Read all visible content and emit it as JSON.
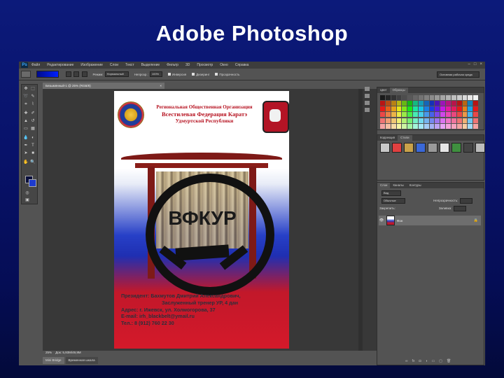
{
  "slide_title": "Adobe Photoshop",
  "photoshop": {
    "app_logo": "Ps",
    "menu": [
      "Файл",
      "Редактирование",
      "Изображение",
      "Слои",
      "Текст",
      "Выделение",
      "Фильтр",
      "3D",
      "Просмотр",
      "Окно",
      "Справка"
    ],
    "window_controls": [
      "–",
      "□",
      "×"
    ],
    "options_bar": {
      "mode_label": "Режим:",
      "mode_value": "Нормальный",
      "opacity_label": "Непрозр.:",
      "opacity_value": "100%",
      "checkboxes": [
        "Инверсия",
        "Дизеринг",
        "Прозрачность"
      ],
      "workspace": "Основная рабочая среда"
    },
    "document_tab": "Безымянный-1 @ 25% (RGB/8)",
    "tab_close": "×",
    "status": {
      "zoom": "25%",
      "doc_info": "Док: 5,93M/49,9M"
    },
    "bottom_tabs": [
      "Mini Bridge",
      "Временная шкала"
    ],
    "panels": {
      "swatches_tabs": [
        "Цвет",
        "Образцы"
      ],
      "styles_tabs": [
        "Коррекция",
        "Стили"
      ],
      "layers_tabs": [
        "Слои",
        "Каналы",
        "Контуры"
      ],
      "layers_kind": "Вид",
      "blend_mode": "Обычные",
      "opacity_label": "Непрозрачность:",
      "lock_label": "Закрепить:",
      "fill_label": "Заливка:",
      "layer_name": "Фон",
      "layer_lock": "🔒",
      "eye_icon": "👁"
    },
    "colors": {
      "foreground": "#0a0f3d",
      "background": "#1d3bcf",
      "accent_red": "#c2182a",
      "accent_blue": "#2740c7"
    }
  },
  "poster": {
    "org_line1": "Региональная Общественная Организация",
    "org_line2": "Всестилевая Федерация Каратэ",
    "org_line3": "Удмуртской Республики",
    "brand": "ВФКУР",
    "contacts": [
      "Президент: Бахмутов Дмитрий Александрович,",
      "Заслуженный тренер УР, 4 дан",
      "Адрес: г. Ижевск, ул. Холмогорова, 37",
      "E-mail: irh_blackbelt@ymail.ru",
      "Тел.: 8 (912) 760 22 30"
    ]
  }
}
